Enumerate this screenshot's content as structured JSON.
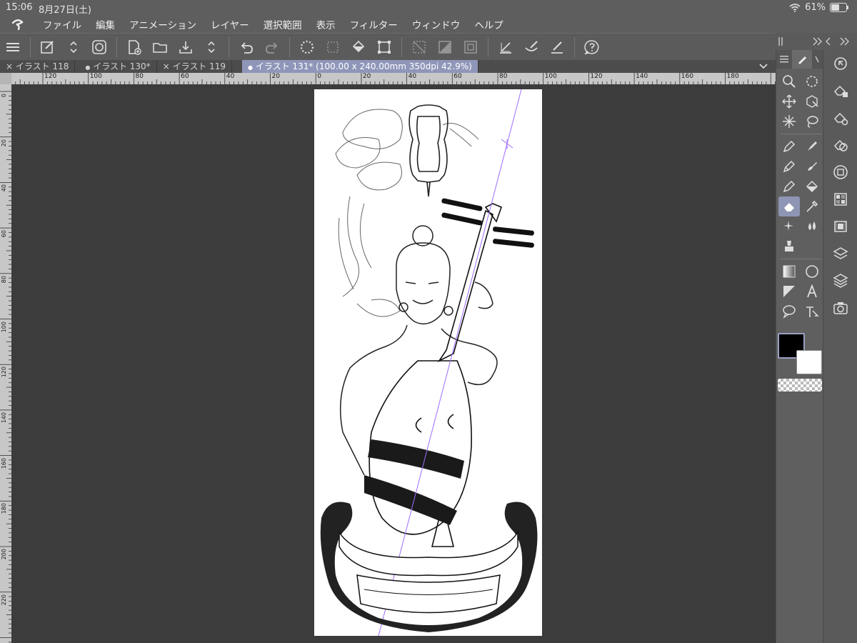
{
  "status": {
    "time": "15:06",
    "date": "8月27日(土)",
    "battery": "61%",
    "battery_level": 0.61
  },
  "menu": [
    "ファイル",
    "編集",
    "アニメーション",
    "レイヤー",
    "選択範囲",
    "表示",
    "フィルター",
    "ウィンドウ",
    "ヘルプ"
  ],
  "tabs": [
    {
      "label": "イラスト 118",
      "marker": "×"
    },
    {
      "label": "イラスト 130*",
      "marker": "●"
    },
    {
      "label": "イラスト 119",
      "marker": "×"
    },
    {
      "label": "イラスト 131* (100.00 x 240.00mm 350dpi 42.9%)",
      "marker": "●"
    }
  ],
  "ruler": {
    "h_labels": [
      "120",
      "100",
      "80",
      "60",
      "40",
      "20",
      "0",
      "20",
      "40",
      "60",
      "80",
      "100",
      "120",
      "140",
      "160",
      "180"
    ],
    "v_labels": [
      "0",
      "20",
      "40",
      "60",
      "80",
      "100",
      "120",
      "140",
      "160",
      "180",
      "200",
      "220"
    ]
  },
  "colors": {
    "main": "#000000",
    "sub": "#ffffff",
    "tab_active": "#8f96b9",
    "tool_selected": "#8e95b5"
  }
}
